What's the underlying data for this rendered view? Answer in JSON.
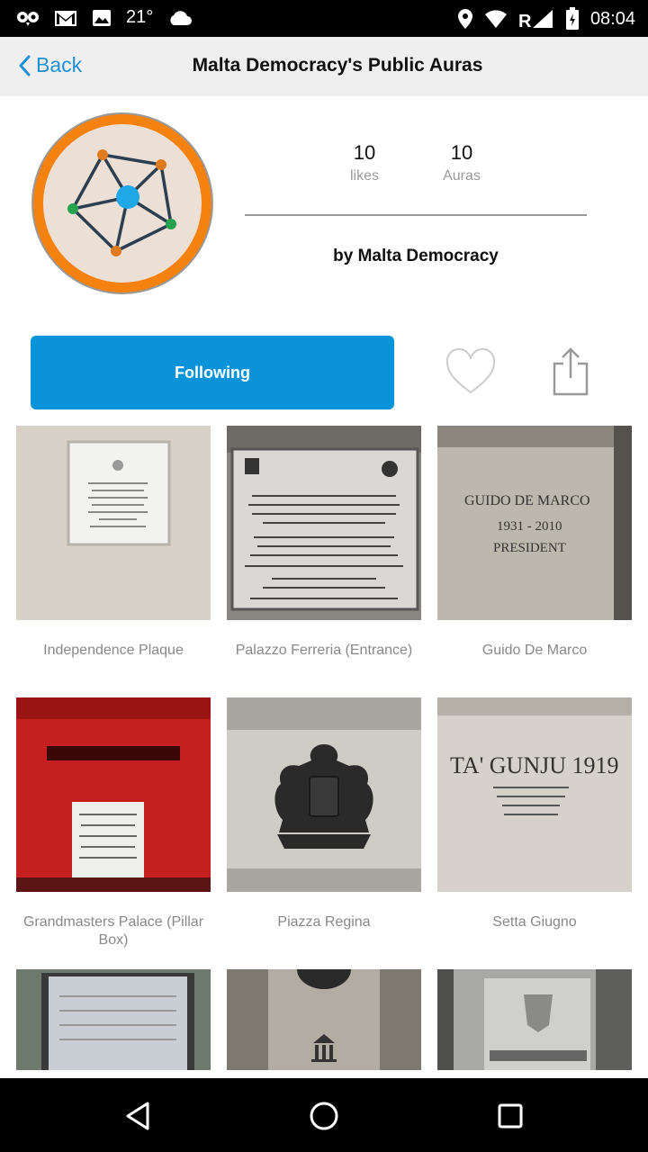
{
  "status_bar": {
    "temperature": "21°",
    "time": "08:04"
  },
  "nav": {
    "back_label": "Back",
    "title": "Malta Democracy's Public Auras"
  },
  "profile": {
    "likes_count": "10",
    "likes_label": "likes",
    "auras_count": "10",
    "auras_label": "Auras",
    "byline": "by Malta Democracy"
  },
  "actions": {
    "following_label": "Following"
  },
  "grid": [
    {
      "caption": "Independence Plaque",
      "photo": "marble-plaque-icon"
    },
    {
      "caption": "Palazzo Ferreria (Entrance)",
      "photo": "stone-plaque-icon"
    },
    {
      "caption": "Guido De Marco",
      "photo": "engraved-stone-icon"
    },
    {
      "caption": "Grandmasters Palace (Pillar Box)",
      "photo": "red-postbox-icon"
    },
    {
      "caption": "Piazza Regina",
      "photo": "coat-of-arms-icon"
    },
    {
      "caption": "Setta Giugno",
      "photo": "engraved-stone-icon"
    },
    {
      "caption": "",
      "photo": "notice-board-icon"
    },
    {
      "caption": "",
      "photo": "unesco-plaque-icon"
    },
    {
      "caption": "",
      "photo": "parliament-sign-icon"
    }
  ],
  "photo_texts": {
    "guido_line1": "GUIDO DE MARCO",
    "guido_line2": "1931 - 2010",
    "guido_line3": "PRESIDENT",
    "gunju": "TA' GUNJU 1919"
  },
  "colors": {
    "accent": "#0a93d8",
    "avatar_ring": "#f5820f",
    "node_blue": "#1ea8e8",
    "node_green": "#27a34f",
    "node_orange": "#e07a1e"
  }
}
